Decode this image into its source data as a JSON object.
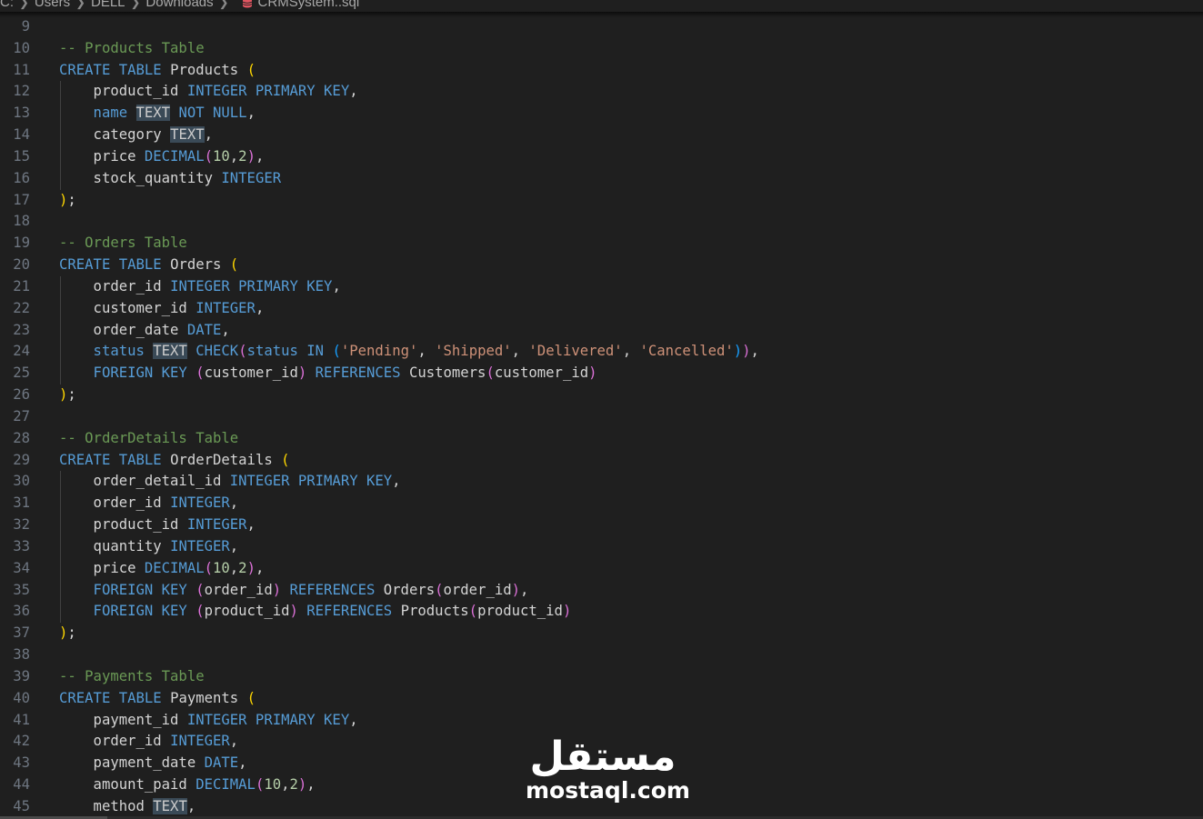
{
  "breadcrumb": {
    "items": [
      "C:",
      "Users",
      "DELL",
      "Downloads"
    ],
    "file": "CRMSystem..sql",
    "file_icon": "database-icon"
  },
  "colors": {
    "background": "#1f1f1f",
    "keyword": "#569cd6",
    "comment": "#6a9955",
    "string": "#ce9178",
    "number": "#b5cea8",
    "identifier": "#d4d4d4",
    "bracket_1": "#ffd700",
    "bracket_2": "#da70d6",
    "bracket_3": "#179fff",
    "selection_highlight": "#3a4a57"
  },
  "editor": {
    "lines": [
      {
        "n": "9",
        "tokens": []
      },
      {
        "n": "10",
        "tokens": [
          [
            "cm",
            "-- Products Table"
          ]
        ]
      },
      {
        "n": "11",
        "tokens": [
          [
            "kw",
            "CREATE TABLE "
          ],
          [
            "id",
            "Products "
          ],
          [
            "p1",
            "("
          ]
        ]
      },
      {
        "n": "12",
        "tokens": [
          [
            "id",
            "    product_id "
          ],
          [
            "kw",
            "INTEGER PRIMARY KEY"
          ],
          [
            "id",
            ","
          ]
        ]
      },
      {
        "n": "13",
        "tokens": [
          [
            "kw",
            "    name "
          ],
          [
            "hl",
            "TEXT"
          ],
          [
            "kw",
            " NOT NULL"
          ],
          [
            "id",
            ","
          ]
        ]
      },
      {
        "n": "14",
        "tokens": [
          [
            "id",
            "    category "
          ],
          [
            "hl",
            "TEXT"
          ],
          [
            "id",
            ","
          ]
        ]
      },
      {
        "n": "15",
        "tokens": [
          [
            "id",
            "    price "
          ],
          [
            "kw",
            "DECIMAL"
          ],
          [
            "p2",
            "("
          ],
          [
            "num",
            "10"
          ],
          [
            "id",
            ","
          ],
          [
            "num",
            "2"
          ],
          [
            "p2",
            ")"
          ],
          [
            "id",
            ","
          ]
        ]
      },
      {
        "n": "16",
        "tokens": [
          [
            "id",
            "    stock_quantity "
          ],
          [
            "kw",
            "INTEGER"
          ]
        ]
      },
      {
        "n": "17",
        "tokens": [
          [
            "p1",
            ")"
          ],
          [
            "id",
            ";"
          ]
        ]
      },
      {
        "n": "18",
        "tokens": []
      },
      {
        "n": "19",
        "tokens": [
          [
            "cm",
            "-- Orders Table"
          ]
        ]
      },
      {
        "n": "20",
        "tokens": [
          [
            "kw",
            "CREATE TABLE "
          ],
          [
            "id",
            "Orders "
          ],
          [
            "p1",
            "("
          ]
        ]
      },
      {
        "n": "21",
        "tokens": [
          [
            "id",
            "    order_id "
          ],
          [
            "kw",
            "INTEGER PRIMARY KEY"
          ],
          [
            "id",
            ","
          ]
        ]
      },
      {
        "n": "22",
        "tokens": [
          [
            "id",
            "    customer_id "
          ],
          [
            "kw",
            "INTEGER"
          ],
          [
            "id",
            ","
          ]
        ]
      },
      {
        "n": "23",
        "tokens": [
          [
            "id",
            "    order_date "
          ],
          [
            "kw",
            "DATE"
          ],
          [
            "id",
            ","
          ]
        ]
      },
      {
        "n": "24",
        "tokens": [
          [
            "kw",
            "    status "
          ],
          [
            "hl",
            "TEXT"
          ],
          [
            "kw",
            " CHECK"
          ],
          [
            "p2",
            "("
          ],
          [
            "kw",
            "status IN "
          ],
          [
            "p3",
            "("
          ],
          [
            "str",
            "'Pending'"
          ],
          [
            "id",
            ", "
          ],
          [
            "str",
            "'Shipped'"
          ],
          [
            "id",
            ", "
          ],
          [
            "str",
            "'Delivered'"
          ],
          [
            "id",
            ", "
          ],
          [
            "str",
            "'Cancelled'"
          ],
          [
            "p3",
            ")"
          ],
          [
            "p2",
            ")"
          ],
          [
            "id",
            ","
          ]
        ]
      },
      {
        "n": "25",
        "tokens": [
          [
            "kw",
            "    FOREIGN KEY "
          ],
          [
            "p2",
            "("
          ],
          [
            "id",
            "customer_id"
          ],
          [
            "p2",
            ")"
          ],
          [
            "kw",
            " REFERENCES "
          ],
          [
            "id",
            "Customers"
          ],
          [
            "p2",
            "("
          ],
          [
            "id",
            "customer_id"
          ],
          [
            "p2",
            ")"
          ]
        ]
      },
      {
        "n": "26",
        "tokens": [
          [
            "p1",
            ")"
          ],
          [
            "id",
            ";"
          ]
        ]
      },
      {
        "n": "27",
        "tokens": []
      },
      {
        "n": "28",
        "tokens": [
          [
            "cm",
            "-- OrderDetails Table"
          ]
        ]
      },
      {
        "n": "29",
        "tokens": [
          [
            "kw",
            "CREATE TABLE "
          ],
          [
            "id",
            "OrderDetails "
          ],
          [
            "p1",
            "("
          ]
        ]
      },
      {
        "n": "30",
        "tokens": [
          [
            "id",
            "    order_detail_id "
          ],
          [
            "kw",
            "INTEGER PRIMARY KEY"
          ],
          [
            "id",
            ","
          ]
        ]
      },
      {
        "n": "31",
        "tokens": [
          [
            "id",
            "    order_id "
          ],
          [
            "kw",
            "INTEGER"
          ],
          [
            "id",
            ","
          ]
        ]
      },
      {
        "n": "32",
        "tokens": [
          [
            "id",
            "    product_id "
          ],
          [
            "kw",
            "INTEGER"
          ],
          [
            "id",
            ","
          ]
        ]
      },
      {
        "n": "33",
        "tokens": [
          [
            "id",
            "    quantity "
          ],
          [
            "kw",
            "INTEGER"
          ],
          [
            "id",
            ","
          ]
        ]
      },
      {
        "n": "34",
        "tokens": [
          [
            "id",
            "    price "
          ],
          [
            "kw",
            "DECIMAL"
          ],
          [
            "p2",
            "("
          ],
          [
            "num",
            "10"
          ],
          [
            "id",
            ","
          ],
          [
            "num",
            "2"
          ],
          [
            "p2",
            ")"
          ],
          [
            "id",
            ","
          ]
        ]
      },
      {
        "n": "35",
        "tokens": [
          [
            "kw",
            "    FOREIGN KEY "
          ],
          [
            "p2",
            "("
          ],
          [
            "id",
            "order_id"
          ],
          [
            "p2",
            ")"
          ],
          [
            "kw",
            " REFERENCES "
          ],
          [
            "id",
            "Orders"
          ],
          [
            "p2",
            "("
          ],
          [
            "id",
            "order_id"
          ],
          [
            "p2",
            ")"
          ],
          [
            "id",
            ","
          ]
        ]
      },
      {
        "n": "36",
        "tokens": [
          [
            "kw",
            "    FOREIGN KEY "
          ],
          [
            "p2",
            "("
          ],
          [
            "id",
            "product_id"
          ],
          [
            "p2",
            ")"
          ],
          [
            "kw",
            " REFERENCES "
          ],
          [
            "id",
            "Products"
          ],
          [
            "p2",
            "("
          ],
          [
            "id",
            "product_id"
          ],
          [
            "p2",
            ")"
          ]
        ]
      },
      {
        "n": "37",
        "tokens": [
          [
            "p1",
            ")"
          ],
          [
            "id",
            ";"
          ]
        ]
      },
      {
        "n": "38",
        "tokens": []
      },
      {
        "n": "39",
        "tokens": [
          [
            "cm",
            "-- Payments Table"
          ]
        ]
      },
      {
        "n": "40",
        "tokens": [
          [
            "kw",
            "CREATE TABLE "
          ],
          [
            "id",
            "Payments "
          ],
          [
            "p1",
            "("
          ]
        ]
      },
      {
        "n": "41",
        "tokens": [
          [
            "id",
            "    payment_id "
          ],
          [
            "kw",
            "INTEGER PRIMARY KEY"
          ],
          [
            "id",
            ","
          ]
        ]
      },
      {
        "n": "42",
        "tokens": [
          [
            "id",
            "    order_id "
          ],
          [
            "kw",
            "INTEGER"
          ],
          [
            "id",
            ","
          ]
        ]
      },
      {
        "n": "43",
        "tokens": [
          [
            "id",
            "    payment_date "
          ],
          [
            "kw",
            "DATE"
          ],
          [
            "id",
            ","
          ]
        ]
      },
      {
        "n": "44",
        "tokens": [
          [
            "id",
            "    amount_paid "
          ],
          [
            "kw",
            "DECIMAL"
          ],
          [
            "p2",
            "("
          ],
          [
            "num",
            "10"
          ],
          [
            "id",
            ","
          ],
          [
            "num",
            "2"
          ],
          [
            "p2",
            ")"
          ],
          [
            "id",
            ","
          ]
        ]
      },
      {
        "n": "45",
        "tokens": [
          [
            "id",
            "    method "
          ],
          [
            "hl",
            "TEXT"
          ],
          [
            "id",
            ","
          ]
        ]
      }
    ]
  },
  "watermark": {
    "logo_text": "مستقل",
    "url": "mostaql.com"
  }
}
